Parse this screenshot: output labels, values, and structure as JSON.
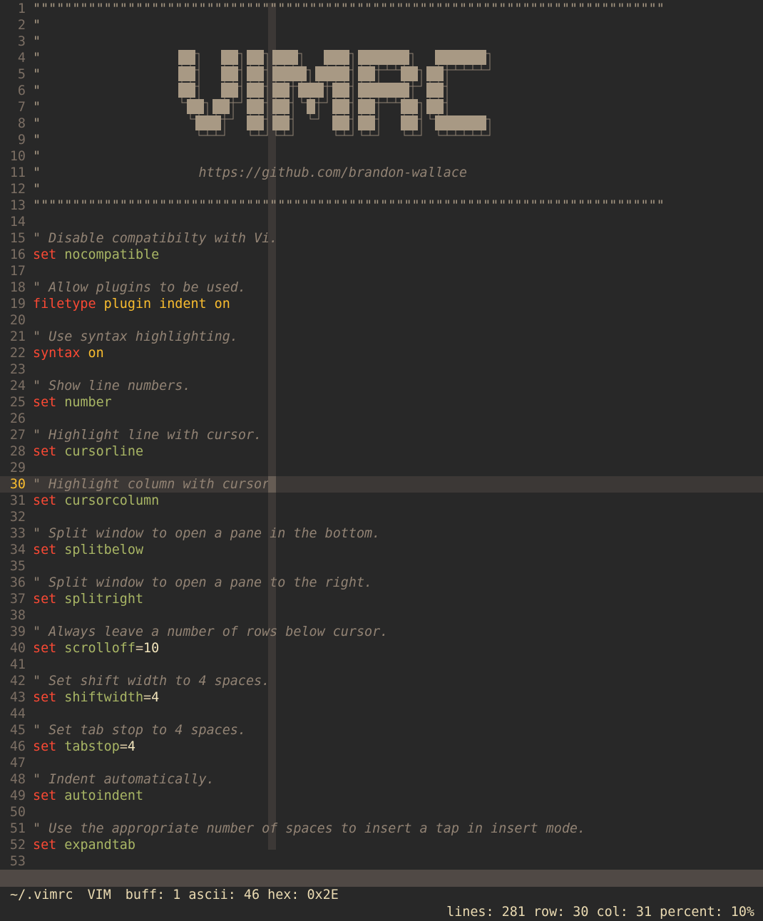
{
  "editor": {
    "current_line": 30,
    "lines": [
      {
        "n": "1",
        "tokens": [
          {
            "t": "banner",
            "s": "\"\"\"\"\"\"\"\"\"\"\"\"\"\"\"\"\"\"\"\"\"\"\"\"\"\"\"\"\"\"\"\"\"\"\"\"\"\"\"\"\"\"\"\"\"\"\"\"\"\"\"\"\"\"\"\"\"\"\"\"\"\"\"\"\"\"\"\"\"\"\"\"\"\"\"\"\"\"\"\""
          }
        ]
      },
      {
        "n": "2",
        "tokens": [
          {
            "t": "banner",
            "s": "\""
          }
        ]
      },
      {
        "n": "3",
        "tokens": [
          {
            "t": "banner",
            "s": "\""
          }
        ]
      },
      {
        "n": "4",
        "tokens": [
          {
            "t": "banner",
            "s": "\""
          }
        ]
      },
      {
        "n": "5",
        "tokens": [
          {
            "t": "banner",
            "s": "\""
          }
        ]
      },
      {
        "n": "6",
        "tokens": [
          {
            "t": "banner",
            "s": "\""
          }
        ]
      },
      {
        "n": "7",
        "tokens": [
          {
            "t": "banner",
            "s": "\""
          }
        ]
      },
      {
        "n": "8",
        "tokens": [
          {
            "t": "banner",
            "s": "\""
          }
        ]
      },
      {
        "n": "9",
        "tokens": [
          {
            "t": "banner",
            "s": "\""
          }
        ]
      },
      {
        "n": "10",
        "tokens": [
          {
            "t": "banner",
            "s": "\""
          }
        ]
      },
      {
        "n": "11",
        "tokens": [
          {
            "t": "banner",
            "s": "\""
          },
          {
            "t": "comment",
            "s": "                    https://github.com/brandon-wallace"
          }
        ]
      },
      {
        "n": "12",
        "tokens": [
          {
            "t": "banner",
            "s": "\""
          }
        ]
      },
      {
        "n": "13",
        "tokens": [
          {
            "t": "banner",
            "s": "\"\"\"\"\"\"\"\"\"\"\"\"\"\"\"\"\"\"\"\"\"\"\"\"\"\"\"\"\"\"\"\"\"\"\"\"\"\"\"\"\"\"\"\"\"\"\"\"\"\"\"\"\"\"\"\"\"\"\"\"\"\"\"\"\"\"\"\"\"\"\"\"\"\"\"\"\"\"\"\""
          }
        ]
      },
      {
        "n": "14",
        "tokens": []
      },
      {
        "n": "15",
        "tokens": [
          {
            "t": "comment",
            "s": "\" Disable compatibilty with Vi."
          }
        ]
      },
      {
        "n": "16",
        "tokens": [
          {
            "t": "keyword",
            "s": "set"
          },
          {
            "t": "plain",
            "s": " "
          },
          {
            "t": "option",
            "s": "nocompatible"
          }
        ]
      },
      {
        "n": "17",
        "tokens": []
      },
      {
        "n": "18",
        "tokens": [
          {
            "t": "comment",
            "s": "\" Allow plugins to be used."
          }
        ]
      },
      {
        "n": "19",
        "tokens": [
          {
            "t": "keyword",
            "s": "filetype"
          },
          {
            "t": "plain",
            "s": " "
          },
          {
            "t": "flag",
            "s": "plugin indent on"
          }
        ]
      },
      {
        "n": "20",
        "tokens": []
      },
      {
        "n": "21",
        "tokens": [
          {
            "t": "comment",
            "s": "\" Use syntax highlighting."
          }
        ]
      },
      {
        "n": "22",
        "tokens": [
          {
            "t": "keyword",
            "s": "syntax"
          },
          {
            "t": "plain",
            "s": " "
          },
          {
            "t": "flag",
            "s": "on"
          }
        ]
      },
      {
        "n": "23",
        "tokens": []
      },
      {
        "n": "24",
        "tokens": [
          {
            "t": "comment",
            "s": "\" Show line numbers."
          }
        ]
      },
      {
        "n": "25",
        "tokens": [
          {
            "t": "keyword",
            "s": "set"
          },
          {
            "t": "plain",
            "s": " "
          },
          {
            "t": "option",
            "s": "number"
          }
        ]
      },
      {
        "n": "26",
        "tokens": []
      },
      {
        "n": "27",
        "tokens": [
          {
            "t": "comment",
            "s": "\" Highlight line with cursor."
          }
        ]
      },
      {
        "n": "28",
        "tokens": [
          {
            "t": "keyword",
            "s": "set"
          },
          {
            "t": "plain",
            "s": " "
          },
          {
            "t": "option",
            "s": "cursorline"
          }
        ]
      },
      {
        "n": "29",
        "tokens": []
      },
      {
        "n": "30",
        "tokens": [
          {
            "t": "comment",
            "s": "\" Highlight column with cursor."
          }
        ]
      },
      {
        "n": "31",
        "tokens": [
          {
            "t": "keyword",
            "s": "set"
          },
          {
            "t": "plain",
            "s": " "
          },
          {
            "t": "option",
            "s": "cursorcolumn"
          }
        ]
      },
      {
        "n": "32",
        "tokens": []
      },
      {
        "n": "33",
        "tokens": [
          {
            "t": "comment",
            "s": "\" Split window to open a pane in the bottom."
          }
        ]
      },
      {
        "n": "34",
        "tokens": [
          {
            "t": "keyword",
            "s": "set"
          },
          {
            "t": "plain",
            "s": " "
          },
          {
            "t": "option",
            "s": "splitbelow"
          }
        ]
      },
      {
        "n": "35",
        "tokens": []
      },
      {
        "n": "36",
        "tokens": [
          {
            "t": "comment",
            "s": "\" Split window to open a pane to the right."
          }
        ]
      },
      {
        "n": "37",
        "tokens": [
          {
            "t": "keyword",
            "s": "set"
          },
          {
            "t": "plain",
            "s": " "
          },
          {
            "t": "option",
            "s": "splitright"
          }
        ]
      },
      {
        "n": "38",
        "tokens": []
      },
      {
        "n": "39",
        "tokens": [
          {
            "t": "comment",
            "s": "\" Always leave a number of rows below cursor."
          }
        ]
      },
      {
        "n": "40",
        "tokens": [
          {
            "t": "keyword",
            "s": "set"
          },
          {
            "t": "plain",
            "s": " "
          },
          {
            "t": "option",
            "s": "scrolloff"
          },
          {
            "t": "plain",
            "s": "="
          },
          {
            "t": "number",
            "s": "10"
          }
        ]
      },
      {
        "n": "41",
        "tokens": []
      },
      {
        "n": "42",
        "tokens": [
          {
            "t": "comment",
            "s": "\" Set shift width to 4 spaces."
          }
        ]
      },
      {
        "n": "43",
        "tokens": [
          {
            "t": "keyword",
            "s": "set"
          },
          {
            "t": "plain",
            "s": " "
          },
          {
            "t": "option",
            "s": "shiftwidth"
          },
          {
            "t": "plain",
            "s": "="
          },
          {
            "t": "number",
            "s": "4"
          }
        ]
      },
      {
        "n": "44",
        "tokens": []
      },
      {
        "n": "45",
        "tokens": [
          {
            "t": "comment",
            "s": "\" Set tab stop to 4 spaces."
          }
        ]
      },
      {
        "n": "46",
        "tokens": [
          {
            "t": "keyword",
            "s": "set"
          },
          {
            "t": "plain",
            "s": " "
          },
          {
            "t": "option",
            "s": "tabstop"
          },
          {
            "t": "plain",
            "s": "="
          },
          {
            "t": "number",
            "s": "4"
          }
        ]
      },
      {
        "n": "47",
        "tokens": []
      },
      {
        "n": "48",
        "tokens": [
          {
            "t": "comment",
            "s": "\" Indent automatically."
          }
        ]
      },
      {
        "n": "49",
        "tokens": [
          {
            "t": "keyword",
            "s": "set"
          },
          {
            "t": "plain",
            "s": " "
          },
          {
            "t": "option",
            "s": "autoindent"
          }
        ]
      },
      {
        "n": "50",
        "tokens": []
      },
      {
        "n": "51",
        "tokens": [
          {
            "t": "comment",
            "s": "\" Use the appropriate number of spaces to insert a tap in insert mode."
          }
        ]
      },
      {
        "n": "52",
        "tokens": [
          {
            "t": "keyword",
            "s": "set"
          },
          {
            "t": "plain",
            "s": " "
          },
          {
            "t": "option",
            "s": "expandtab"
          }
        ]
      },
      {
        "n": "53",
        "tokens": []
      }
    ]
  },
  "logo": {
    "text": "VIMRC",
    "color": "#a89984",
    "shade_color": "#928374"
  },
  "statusbar": {
    "file": "~/.vimrc",
    "mode": "VIM",
    "buff": "buff: 1",
    "ascii": "ascii: 46",
    "hex": "hex: 0x2E",
    "lines": "lines: 281",
    "row": "row: 30",
    "col": "col: 31",
    "percent": "percent: 10%"
  },
  "colors": {
    "background": "#282828",
    "cursorline": "#3c3836",
    "keyword": "#fb4934",
    "option": "#a9b665",
    "flag": "#fabd2f",
    "comment": "#928374",
    "statusbar_bg": "#504945"
  }
}
